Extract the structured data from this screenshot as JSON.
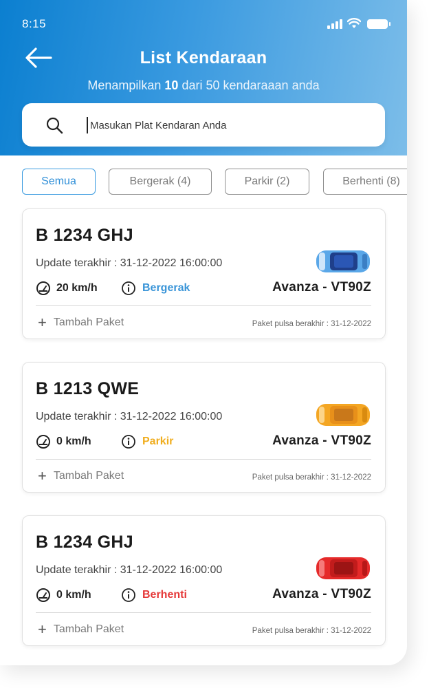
{
  "status_bar": {
    "time": "8:15"
  },
  "header": {
    "title": "List Kendaraan",
    "subtitle_prefix": "Menampilkan ",
    "subtitle_count": "10",
    "subtitle_suffix": " dari 50 kendaraaan anda"
  },
  "search": {
    "placeholder": "Masukan Plat Kendaran Anda",
    "value": ""
  },
  "filters": [
    {
      "label": "Semua",
      "active": true
    },
    {
      "label": "Bergerak (4)",
      "active": false
    },
    {
      "label": "Parkir (2)",
      "active": false
    },
    {
      "label": "Berhenti (8)",
      "active": false
    }
  ],
  "colors": {
    "bergerak": "#3a95d8",
    "parkir": "#f0ad1e",
    "berhenti": "#e53838",
    "car_blue": "#5aa7e8",
    "car_orange": "#f4a623",
    "car_red": "#e52a2a"
  },
  "vehicles": [
    {
      "plate": "B 1234 GHJ",
      "updated": "Update terakhir :  31-12-2022 16:00:00",
      "speed": "20 km/h",
      "status": "Bergerak",
      "model": "Avanza - VT90Z",
      "add_paket": "Tambah Paket",
      "expire": "Paket pulsa berakhir :  31-12-2022",
      "car_icon": "car-blue-icon"
    },
    {
      "plate": "B 1213 QWE",
      "updated": "Update terakhir :  31-12-2022 16:00:00",
      "speed": "0 km/h",
      "status": "Parkir",
      "model": "Avanza - VT90Z",
      "add_paket": "Tambah Paket",
      "expire": "Paket pulsa berakhir :  31-12-2022",
      "car_icon": "car-orange-icon"
    },
    {
      "plate": "B 1234 GHJ",
      "updated": "Update terakhir :  31-12-2022 16:00:00",
      "speed": "0 km/h",
      "status": "Berhenti",
      "model": "Avanza - VT90Z",
      "add_paket": "Tambah Paket",
      "expire": "Paket pulsa berakhir :  31-12-2022",
      "car_icon": "car-red-icon"
    }
  ]
}
